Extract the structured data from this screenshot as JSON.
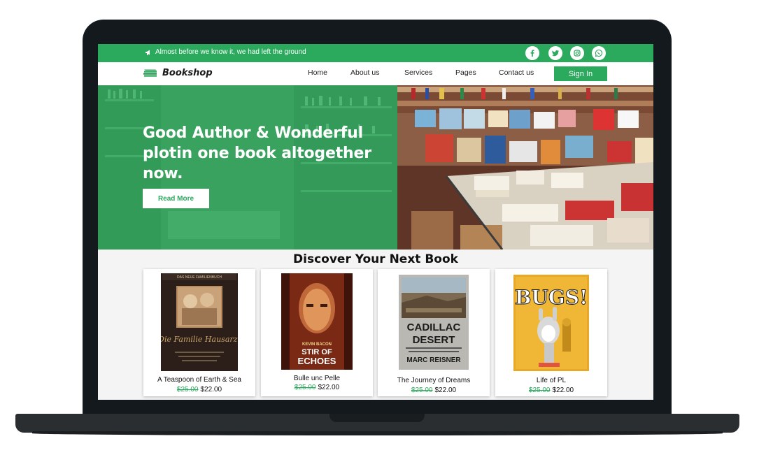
{
  "topbar": {
    "message": "Almost before we know it, we had left the ground",
    "social_icons": [
      "facebook-icon",
      "twitter-icon",
      "instagram-icon",
      "whatsapp-icon"
    ]
  },
  "navbar": {
    "brand": "Bookshop",
    "links": [
      "Home",
      "About us",
      "Services",
      "Pages",
      "Contact us"
    ],
    "signin_label": "Sign In"
  },
  "hero": {
    "title": "Good Author & Wonderful plotin one book altogether now.",
    "button_label": "Read More"
  },
  "books_section": {
    "title": "Discover Your Next Book",
    "books": [
      {
        "title": "A Teaspoon of Earth & Sea",
        "old_price": "$25.00",
        "new_price": "$22.00"
      },
      {
        "title": "Bulle unc Pelle",
        "old_price": "$25.00",
        "new_price": "$22.00"
      },
      {
        "title": "The Journey of Dreams",
        "old_price": "$25.00",
        "new_price": "$22.00"
      },
      {
        "title": "Life of PL",
        "old_price": "$25.00",
        "new_price": "$22.00"
      }
    ],
    "cover_text": {
      "book1_top": "DAS NEUE FAMILIENBUCH",
      "book1_script": "Die Familie Hausarzt",
      "book2_author": "KEVIN BACON",
      "book2_title1": "STIR OF",
      "book2_title2": "ECHOES",
      "book3_title1": "CADILLAC",
      "book3_title2": "DESERT",
      "book3_author": "MARC REISNER",
      "book4_title": "BUGS!"
    }
  },
  "colors": {
    "brand_green": "#2ba95d",
    "laptop_frame": "#14191d"
  }
}
